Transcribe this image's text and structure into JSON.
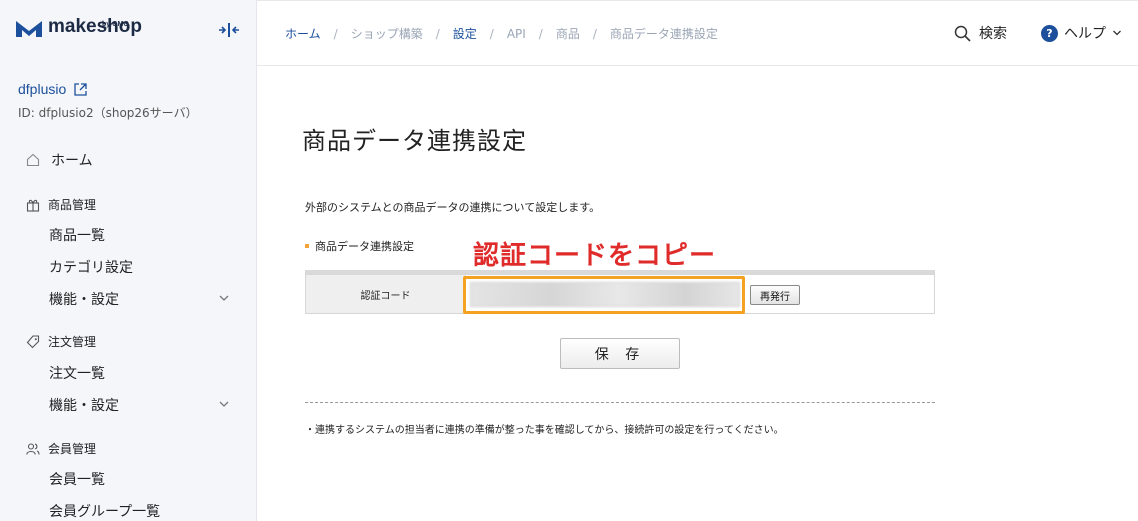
{
  "brand": {
    "name": "makeshop",
    "sub": "by GMO"
  },
  "sidebar": {
    "shop_name": "dfplusio",
    "shop_id": "ID: dfplusio2（shop26サーバ）",
    "home": "ホーム",
    "sections": [
      {
        "label": "商品管理",
        "items": [
          "商品一覧",
          "カテゴリ設定",
          "機能・設定"
        ]
      },
      {
        "label": "注文管理",
        "items": [
          "注文一覧",
          "機能・設定"
        ]
      },
      {
        "label": "会員管理",
        "items": [
          "会員一覧",
          "会員グループ一覧"
        ]
      }
    ]
  },
  "topbar": {
    "breadcrumb": [
      "ホーム",
      "ショップ構築",
      "設定",
      "API",
      "商品",
      "商品データ連携設定"
    ],
    "search_label": "検索",
    "help_label": "ヘルプ"
  },
  "main": {
    "title": "商品データ連携設定",
    "description": "外部のシステムとの商品データの連携について設定します。",
    "subheading": "商品データ連携設定",
    "annotation": "認証コードをコピー",
    "auth_label": "認証コード",
    "auth_value": "",
    "reissue_label": "再発行",
    "save_label": "保 存",
    "note": "・連携するシステムの担当者に連携の準備が整った事を確認してから、接続許可の設定を行ってください。"
  },
  "colors": {
    "accent": "#1c4f9c",
    "highlight_border": "#f4a21f",
    "annotation": "#e02b2b"
  }
}
